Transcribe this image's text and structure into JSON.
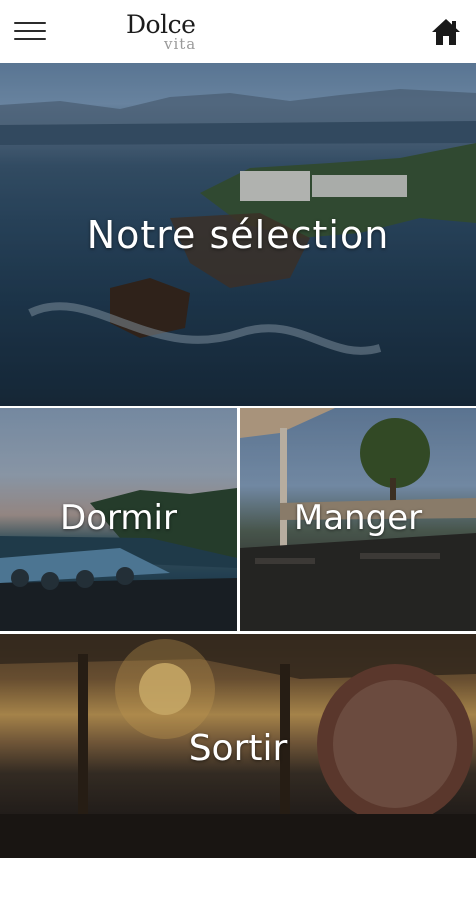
{
  "app": {
    "logo_main": "Dolce",
    "logo_sub": "vita"
  },
  "header": {
    "menu_icon": "hamburger-menu-icon",
    "home_icon": "home-icon"
  },
  "tiles": [
    {
      "key": "selection",
      "label": "Notre sélection"
    },
    {
      "key": "dormir",
      "label": "Dormir"
    },
    {
      "key": "manger",
      "label": "Manger"
    },
    {
      "key": "sortir",
      "label": "Sortir"
    }
  ],
  "colors": {
    "header_bg": "#ffffff",
    "label_text": "#ffffff",
    "icon": "#1a1a1a"
  }
}
